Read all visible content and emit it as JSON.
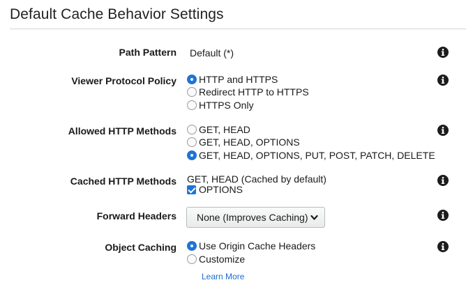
{
  "title": "Default Cache Behavior Settings",
  "path_pattern": {
    "label": "Path Pattern",
    "value": "Default (*)"
  },
  "viewer_protocol_policy": {
    "label": "Viewer Protocol Policy",
    "options": [
      "HTTP and HTTPS",
      "Redirect HTTP to HTTPS",
      "HTTPS Only"
    ],
    "selected": "HTTP and HTTPS"
  },
  "allowed_http_methods": {
    "label": "Allowed HTTP Methods",
    "options": [
      "GET, HEAD",
      "GET, HEAD, OPTIONS",
      "GET, HEAD, OPTIONS, PUT, POST, PATCH, DELETE"
    ],
    "selected": "GET, HEAD, OPTIONS, PUT, POST, PATCH, DELETE"
  },
  "cached_http_methods": {
    "label": "Cached HTTP Methods",
    "default_text": "GET, HEAD (Cached by default)",
    "options_checkbox": {
      "label": "OPTIONS",
      "checked": true
    }
  },
  "forward_headers": {
    "label": "Forward Headers",
    "selected": "None (Improves Caching)"
  },
  "object_caching": {
    "label": "Object Caching",
    "options": [
      "Use Origin Cache Headers",
      "Customize"
    ],
    "selected": "Use Origin Cache Headers"
  },
  "learn_more": "Learn More",
  "colors": {
    "accent": "#1f74d8",
    "link": "#1a6ed0",
    "info_icon": "#1c1c1c",
    "rule": "#cfd3d6"
  },
  "icons": {
    "info": "info-icon",
    "dropdown": "chevron-down-icon",
    "radio": "radio-icon",
    "checkbox": "checkbox-icon"
  }
}
